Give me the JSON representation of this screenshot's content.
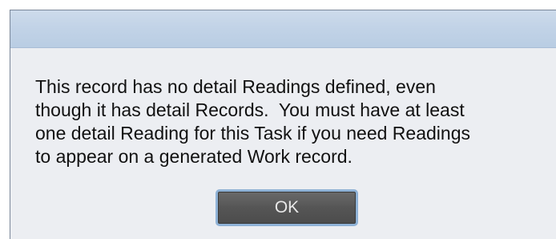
{
  "dialog": {
    "message_lines": [
      "This record has no detail Readings defined, even",
      "though it has detail Records.  You must have at least",
      "one detail Reading for this Task if you need Readings",
      "to appear on a generated Work record."
    ],
    "ok_label": "OK"
  },
  "colors": {
    "titlebar": "#c2d3e7",
    "content_background": "#eceef2",
    "button_fill": "#555555",
    "button_focus_border": "#8fb2d6"
  }
}
